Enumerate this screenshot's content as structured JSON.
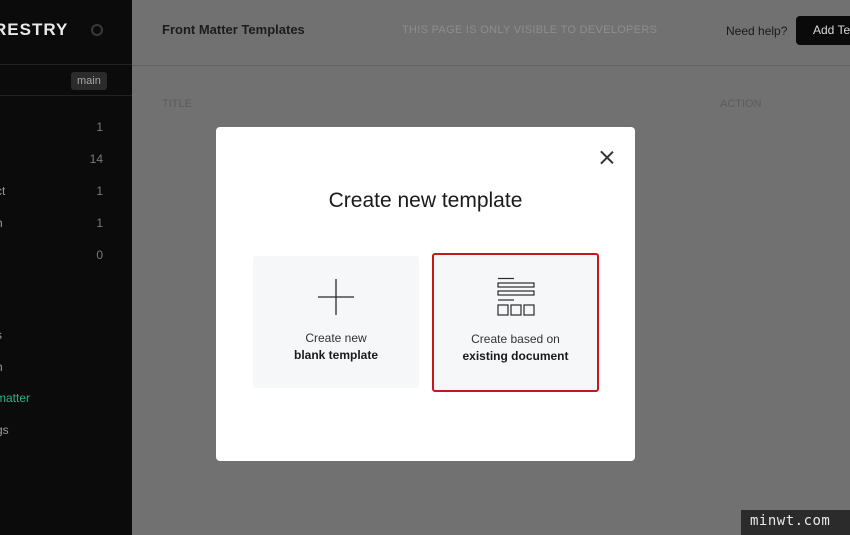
{
  "sidebar": {
    "brand": "RESTRY",
    "branch": "main",
    "items": [
      {
        "label": "t",
        "count": "1"
      },
      {
        "label": "",
        "count": "14"
      },
      {
        "label": "ct",
        "count": "1"
      },
      {
        "label": "h",
        "count": "1"
      },
      {
        "label": ".",
        "count": "0"
      },
      {
        "label": "s",
        "count": ""
      },
      {
        "label": "n",
        "count": ""
      },
      {
        "label": "matter",
        "count": ""
      },
      {
        "label": "gs",
        "count": ""
      }
    ]
  },
  "header": {
    "title": "Front Matter Templates",
    "dev_note": "THIS PAGE IS ONLY VISIBLE TO DEVELOPERS",
    "help": "Need help?",
    "add_button": "Add Te"
  },
  "table": {
    "col_title": "TITLE",
    "col_action": "ACTION"
  },
  "modal": {
    "title": "Create new template",
    "options": [
      {
        "line1": "Create new",
        "line2": "blank template",
        "icon": "plus-icon"
      },
      {
        "line1": "Create based on",
        "line2": "existing document",
        "icon": "document-layout-icon"
      }
    ],
    "highlight_color": "#c8161d"
  },
  "watermark": "minwt.com"
}
